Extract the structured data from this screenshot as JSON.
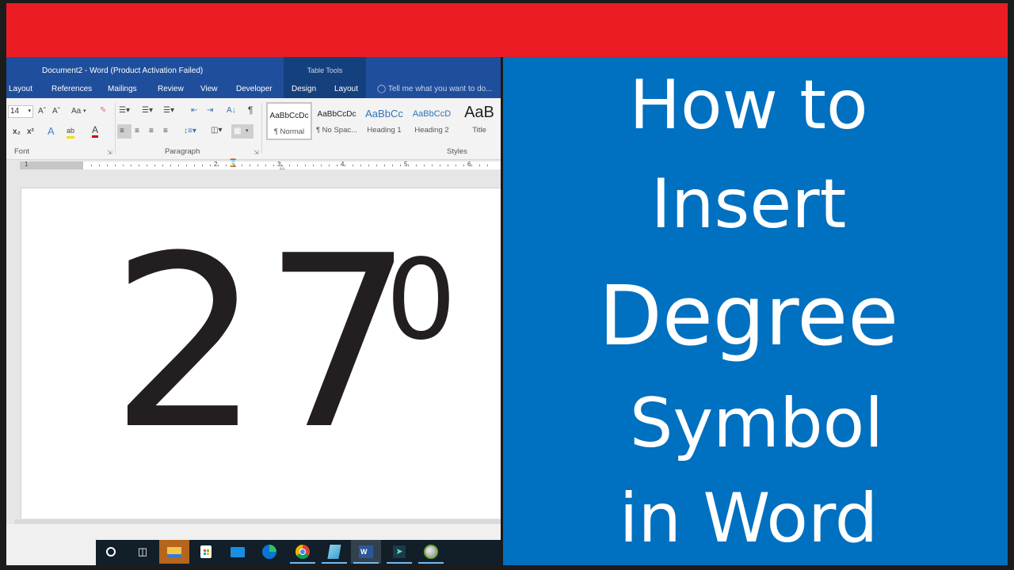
{
  "banner": {
    "color": "#ec1c24"
  },
  "word": {
    "window_title": "Document2 - Word (Product Activation Failed)",
    "contextual_group": "Table Tools",
    "tabs": [
      {
        "label": "Layout"
      },
      {
        "label": "References"
      },
      {
        "label": "Mailings"
      },
      {
        "label": "Review"
      },
      {
        "label": "View"
      },
      {
        "label": "Developer"
      },
      {
        "label": "Design"
      },
      {
        "label": "Layout"
      }
    ],
    "tell_me_placeholder": "Tell me what you want to do...",
    "ribbon": {
      "font_size": "14",
      "font_group_label": "Font",
      "paragraph_group_label": "Paragraph",
      "styles_group_label": "Styles",
      "font_buttons": {
        "grow": "Aˆ",
        "shrink": "Aˇ",
        "change_case": "Aa",
        "subscript": "x₂",
        "superscript": "x²",
        "text_effects": "A",
        "highlight": "ab",
        "font_color": "A"
      },
      "paragraph_buttons": {
        "sort": "A↓",
        "show_marks": "¶"
      },
      "styles": [
        {
          "sample": "AaBbCcDc",
          "name": "¶ Normal",
          "active": true
        },
        {
          "sample": "AaBbCcDc",
          "name": "¶ No Spac...",
          "active": false
        },
        {
          "sample": "AaBbCc",
          "name": "Heading 1",
          "active": false
        },
        {
          "sample": "AaBbCcD",
          "name": "Heading 2",
          "active": false
        },
        {
          "sample": "AaB",
          "name": "Title",
          "active": false
        }
      ]
    },
    "ruler": {
      "numbers": [
        "1",
        "2",
        "3",
        "4",
        "5",
        "6"
      ]
    },
    "document": {
      "number": "27",
      "superscript": "0"
    },
    "taskbar": {
      "icons": [
        {
          "name": "cortana-search",
          "running": false,
          "active": false
        },
        {
          "name": "task-view",
          "running": false,
          "active": false
        },
        {
          "name": "file-explorer",
          "running": false,
          "active": true
        },
        {
          "name": "microsoft-store",
          "running": false,
          "active": false
        },
        {
          "name": "mail",
          "running": false,
          "active": false
        },
        {
          "name": "edge",
          "running": false,
          "active": false
        },
        {
          "name": "chrome",
          "running": true,
          "active": false
        },
        {
          "name": "notepad",
          "running": true,
          "active": false
        },
        {
          "name": "word",
          "running": true,
          "active": true
        },
        {
          "name": "filmora",
          "running": true,
          "active": false
        },
        {
          "name": "greenshot",
          "running": true,
          "active": false
        }
      ]
    }
  },
  "headline": {
    "lines": [
      "How to",
      "Insert",
      "Degree",
      "Symbol",
      "in Word"
    ],
    "background": "#0070c0",
    "text_color": "#ffffff"
  }
}
